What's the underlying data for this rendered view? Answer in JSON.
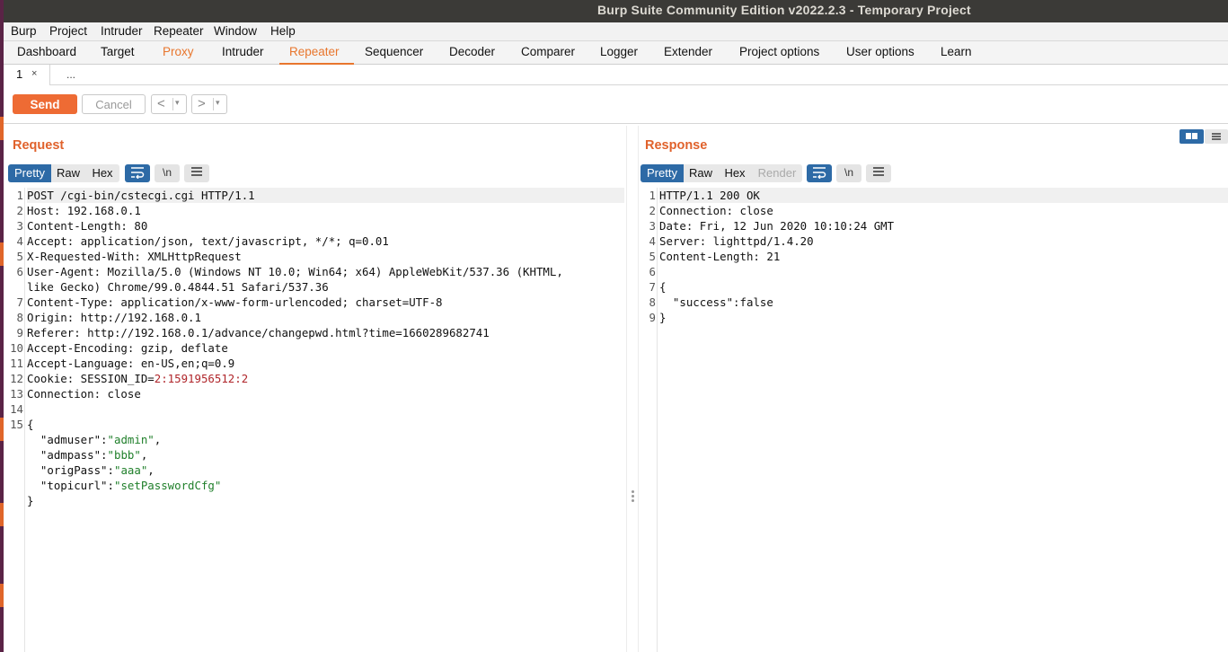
{
  "window": {
    "title": "Burp Suite Community Edition v2022.2.3 - Temporary Project"
  },
  "menu": [
    "Burp",
    "Project",
    "Intruder",
    "Repeater",
    "Window",
    "Help"
  ],
  "tabs": [
    "Dashboard",
    "Target",
    "Proxy",
    "Intruder",
    "Repeater",
    "Sequencer",
    "Decoder",
    "Comparer",
    "Logger",
    "Extender",
    "Project options",
    "User options",
    "Learn"
  ],
  "active_tab": "Repeater",
  "subtabs": {
    "first": "1",
    "close": "×",
    "more": "..."
  },
  "toolbar": {
    "send": "Send",
    "cancel": "Cancel",
    "back": "<",
    "forward": ">",
    "dropdown": "▾"
  },
  "request": {
    "title": "Request",
    "views": [
      "Pretty",
      "Raw",
      "Hex"
    ],
    "newline_label": "\\n",
    "lines": [
      "POST /cgi-bin/cstecgi.cgi HTTP/1.1",
      "Host: 192.168.0.1",
      "Content-Length: 80",
      "Accept: application/json, text/javascript, */*; q=0.01",
      "X-Requested-With: XMLHttpRequest",
      "User-Agent: Mozilla/5.0 (Windows NT 10.0; Win64; x64) AppleWebKit/537.36 (KHTML,",
      "like Gecko) Chrome/99.0.4844.51 Safari/537.36",
      "Content-Type: application/x-www-form-urlencoded; charset=UTF-8",
      "Origin: http://192.168.0.1",
      "Referer: http://192.168.0.1/advance/changepwd.html?time=1660289682741",
      "Accept-Encoding: gzip, deflate",
      "Accept-Language: en-US,en;q=0.9",
      "Cookie: SESSION_ID=",
      "2:1591956512:2",
      "Connection: close",
      "{",
      "\"admuser\":",
      "\"admin\"",
      "\"admpass\":",
      "\"bbb\"",
      "\"origPass\":",
      "\"aaa\"",
      "\"topicurl\":",
      "\"setPasswordCfg\"",
      "}"
    ]
  },
  "response": {
    "title": "Response",
    "views": [
      "Pretty",
      "Raw",
      "Hex",
      "Render"
    ],
    "newline_label": "\\n",
    "lines": [
      "HTTP/1.1 200 OK",
      "Connection: close",
      "Date: Fri, 12 Jun 2020 10:10:24 GMT",
      "Server: lighttpd/1.4.20",
      "Content-Length: 21",
      "{",
      "\"success\":false",
      "}"
    ]
  },
  "colors": {
    "accent": "#e8762d",
    "view_active": "#2d6aa6",
    "string": "#1f7f2a",
    "cookie": "#b0262b"
  },
  "icons": [
    "wrap-lines-icon",
    "newline-icon",
    "menu-icon",
    "split-view-icon",
    "stacked-view-icon",
    "close-icon"
  ]
}
